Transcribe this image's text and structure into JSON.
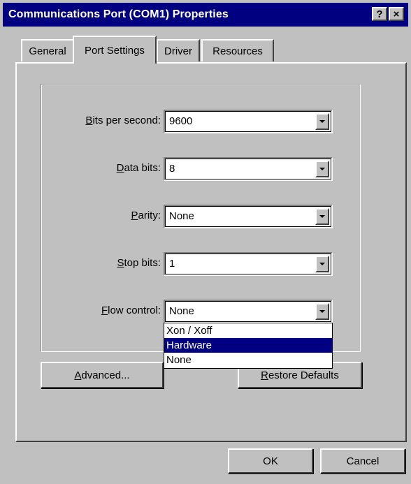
{
  "window": {
    "title": "Communications Port (COM1) Properties",
    "help_button": "?",
    "close_button": "×"
  },
  "tabs": [
    {
      "label": "General",
      "active": false
    },
    {
      "label": "Port Settings",
      "active": true
    },
    {
      "label": "Driver",
      "active": false
    },
    {
      "label": "Resources",
      "active": false
    }
  ],
  "fields": {
    "bits_per_second": {
      "label_mnemonic": "B",
      "label_rest": "its per second:",
      "value": "9600"
    },
    "data_bits": {
      "label_mnemonic": "D",
      "label_rest": "ata bits:",
      "value": "8"
    },
    "parity": {
      "label_mnemonic": "P",
      "label_rest": "arity:",
      "value": "None"
    },
    "stop_bits": {
      "label_mnemonic": "S",
      "label_rest": "top bits:",
      "value": "1"
    },
    "flow_control": {
      "label_mnemonic": "F",
      "label_rest": "low control:",
      "value": "None"
    }
  },
  "flow_control_dropdown": {
    "options": [
      "Xon / Xoff",
      "Hardware",
      "None"
    ],
    "highlighted": "Hardware"
  },
  "buttons": {
    "advanced": {
      "mnemonic": "A",
      "rest": "dvanced..."
    },
    "restore_defaults": {
      "mnemonic": "R",
      "rest": "estore Defaults"
    },
    "ok": "OK",
    "cancel": "Cancel"
  },
  "colors": {
    "titlebar": "#000080",
    "face": "#c0c0c0",
    "selection": "#000080"
  }
}
